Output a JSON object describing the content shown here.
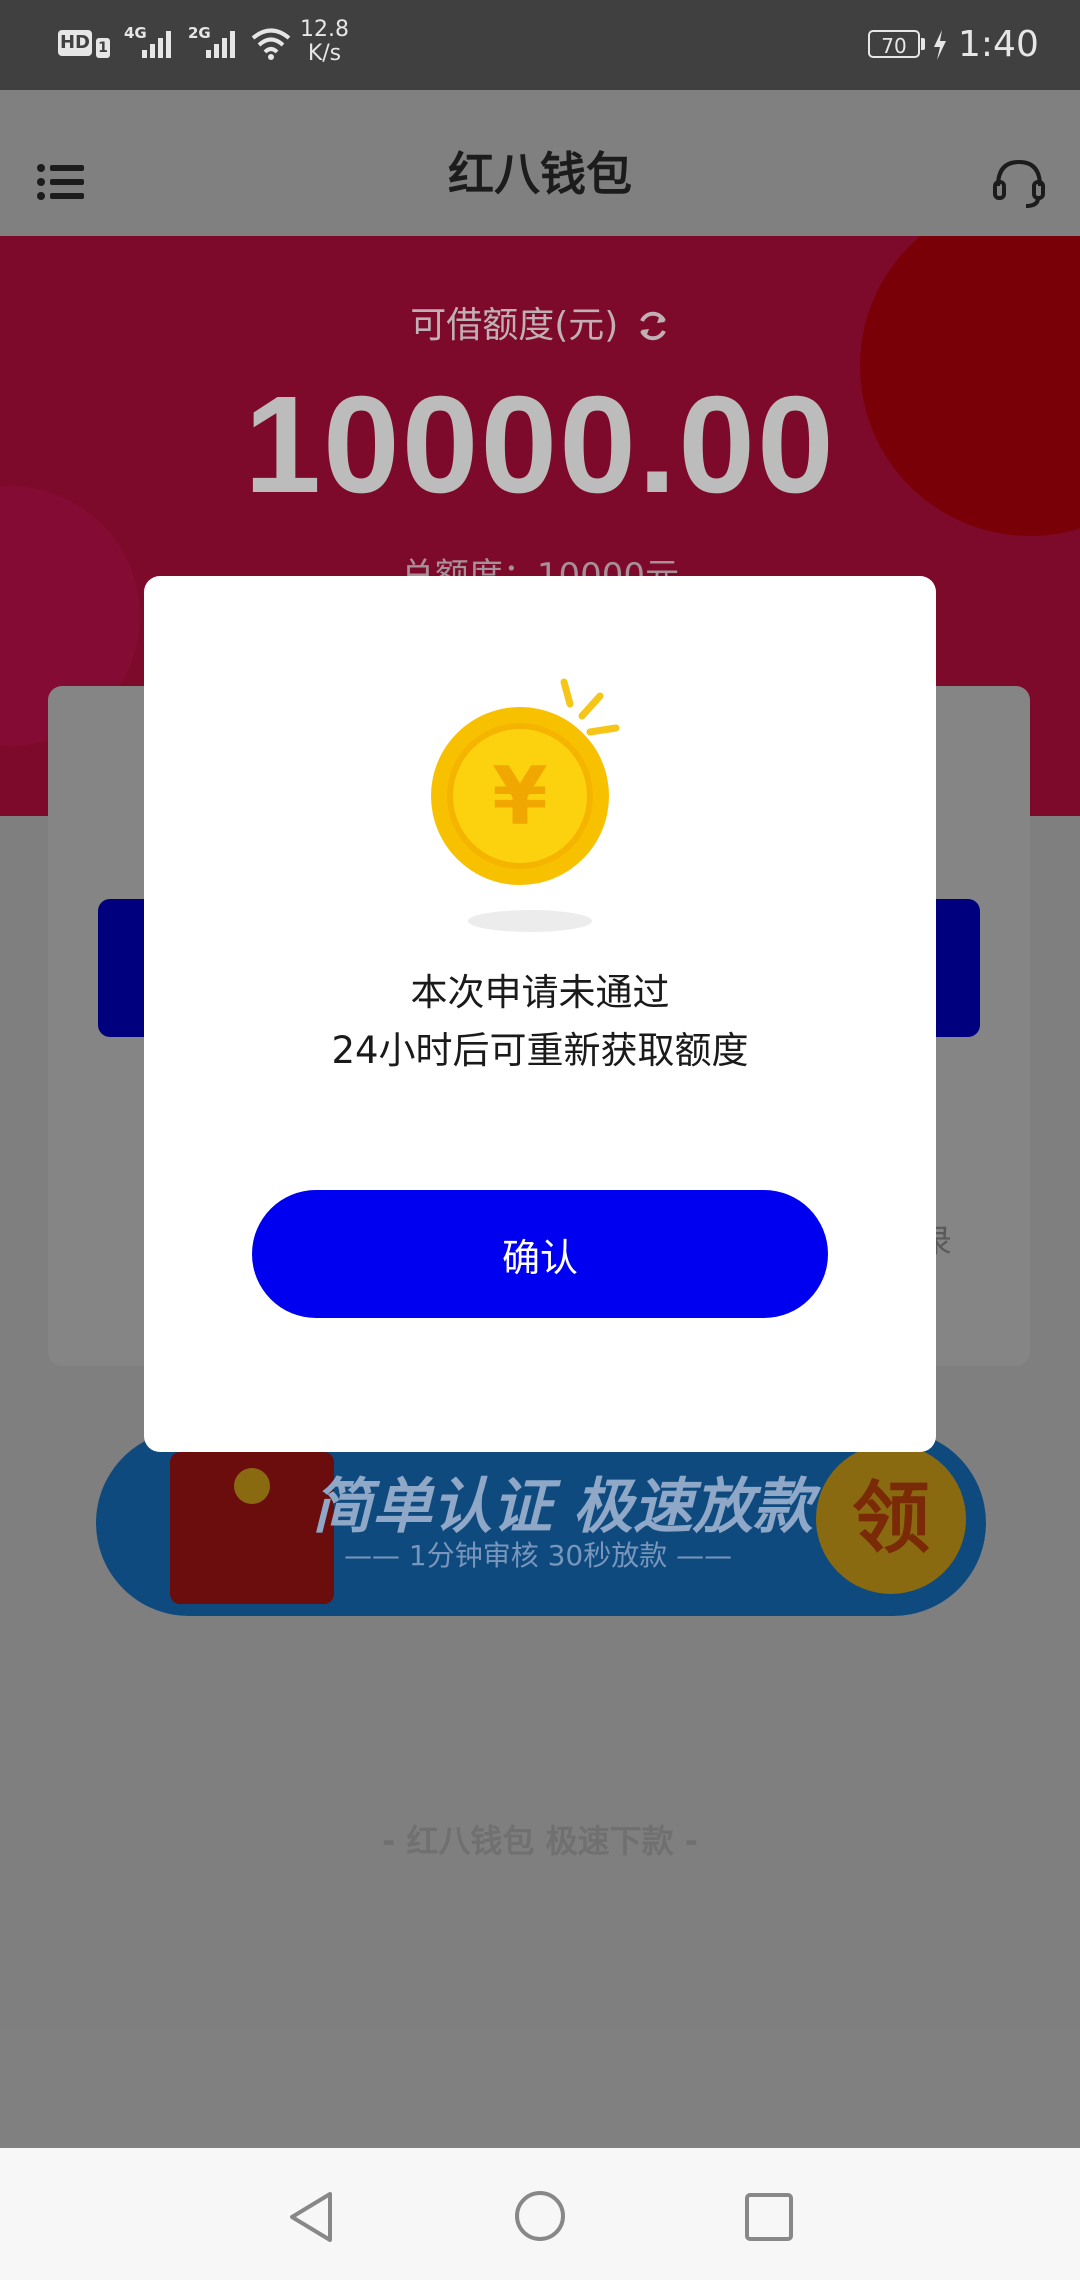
{
  "status_bar": {
    "hd": "HD",
    "sim": "1",
    "net1": "4G",
    "net2": "2G",
    "speed_value": "12.8",
    "speed_unit": "K/s",
    "battery": "70",
    "time": "1:40"
  },
  "app_bar": {
    "title": "红八钱包",
    "menu_icon": "menu-icon",
    "support_icon": "headset-icon"
  },
  "hero": {
    "label": "可借额度(元)",
    "refresh_icon": "refresh-icon",
    "amount": "10000.00",
    "total": "总额度：10000元"
  },
  "card": {
    "records_fragment": "录"
  },
  "banner": {
    "headline": "简单认证  极速放款",
    "sub": "—— 1分钟审核  30秒放款 ——",
    "badge": "领"
  },
  "footer": {
    "slogan": "-  红八钱包  极速下款  -"
  },
  "modal": {
    "icon": "gold-coin-icon",
    "line1": "本次申请未通过",
    "line2": "24小时后可重新获取额度",
    "confirm_label": "确认"
  },
  "colors": {
    "primary_blue": "#0000f0",
    "brand_red": "#e8174a"
  },
  "nav": {
    "back_icon": "back-triangle-icon",
    "home_icon": "home-circle-icon",
    "recents_icon": "recents-square-icon"
  }
}
